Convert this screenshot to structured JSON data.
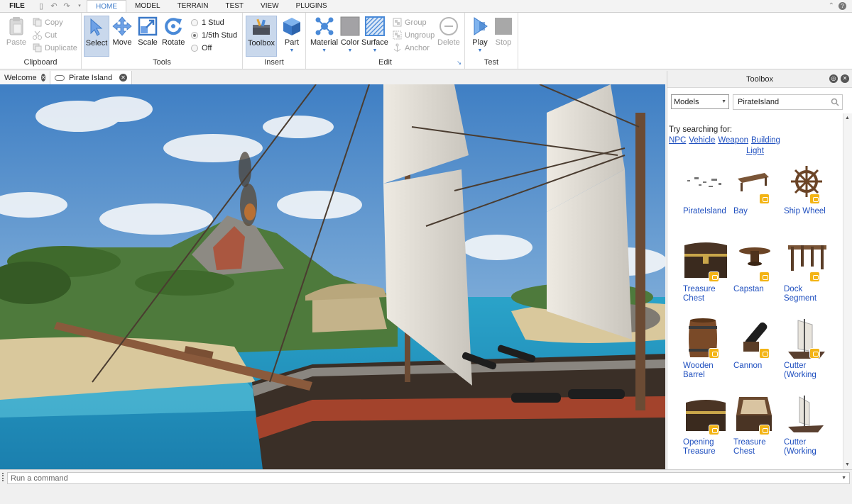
{
  "menubar": {
    "file": "FILE",
    "tabs": [
      "HOME",
      "MODEL",
      "TERRAIN",
      "TEST",
      "VIEW",
      "PLUGINS"
    ],
    "active_tab": "HOME"
  },
  "ribbon": {
    "clipboard": {
      "paste": "Paste",
      "copy": "Copy",
      "cut": "Cut",
      "duplicate": "Duplicate",
      "label": "Clipboard"
    },
    "tools": {
      "select": "Select",
      "move": "Move",
      "scale": "Scale",
      "rotate": "Rotate",
      "label": "Tools"
    },
    "snap": {
      "options": [
        "1 Stud",
        "1/5th Stud",
        "Off"
      ],
      "selected": "1/5th Stud"
    },
    "insert": {
      "toolbox": "Toolbox",
      "part": "Part",
      "label": "Insert"
    },
    "edit": {
      "material": "Material",
      "color": "Color",
      "surface": "Surface",
      "group": "Group",
      "ungroup": "Ungroup",
      "anchor": "Anchor",
      "delete": "Delete",
      "label": "Edit"
    },
    "test": {
      "play": "Play",
      "stop": "Stop",
      "label": "Test"
    }
  },
  "doc_tabs": [
    {
      "label": "Welcome",
      "active": false
    },
    {
      "label": "Pirate Island",
      "active": true
    }
  ],
  "toolbox": {
    "title": "Toolbox",
    "category": "Models",
    "search_value": "PirateIsland",
    "suggest_prefix": "Try searching for:",
    "suggestions": [
      "NPC",
      "Vehicle",
      "Weapon",
      "Building",
      "Light"
    ],
    "items": [
      {
        "name": "PirateIsland",
        "icon": "island-icon",
        "badge": false
      },
      {
        "name": "Bay",
        "icon": "bench-icon",
        "badge": true
      },
      {
        "name": "Ship Wheel",
        "icon": "ship-wheel-icon",
        "badge": true
      },
      {
        "name": "Treasure Chest",
        "icon": "treasure-chest-icon",
        "badge": true
      },
      {
        "name": "Capstan",
        "icon": "capstan-icon",
        "badge": true
      },
      {
        "name": "Dock Segment",
        "icon": "dock-icon",
        "badge": true
      },
      {
        "name": "Wooden Barrel",
        "icon": "barrel-icon",
        "badge": true
      },
      {
        "name": "Cannon",
        "icon": "cannon-icon",
        "badge": true
      },
      {
        "name": "Cutter (Working",
        "icon": "ship-icon",
        "badge": true
      },
      {
        "name": "Opening Treasure",
        "icon": "treasure-chest-icon",
        "badge": true
      },
      {
        "name": "Treasure Chest",
        "icon": "chest-open-icon",
        "badge": true
      },
      {
        "name": "Cutter (Working",
        "icon": "ship-icon",
        "badge": false
      }
    ]
  },
  "command_bar": {
    "placeholder": "Run a command"
  },
  "colors": {
    "accent": "#3b79c8",
    "link": "#1f4fbf",
    "badge": "#f3b415"
  }
}
